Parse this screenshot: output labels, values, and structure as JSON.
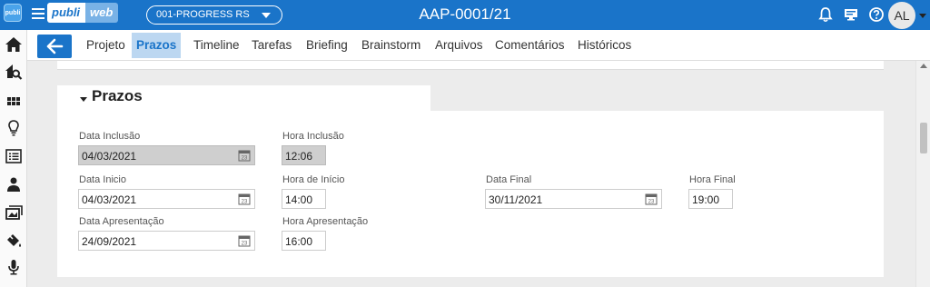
{
  "app": {
    "logo_text": "publi",
    "brand_left": "publi",
    "brand_right": "web",
    "company": "001-PROGRESS RS",
    "record_id": "AAP-0001/21",
    "user_initials": "AL"
  },
  "tabs": [
    {
      "label": "Projeto",
      "active": false
    },
    {
      "label": "Prazos",
      "active": true
    },
    {
      "label": "Timeline",
      "active": false
    },
    {
      "label": "Tarefas",
      "active": false
    },
    {
      "label": "Briefing",
      "active": false
    },
    {
      "label": "Brainstorm",
      "active": false
    },
    {
      "label": "Arquivos",
      "active": false
    },
    {
      "label": "Comentários",
      "active": false
    },
    {
      "label": "Históricos",
      "active": false
    }
  ],
  "section": {
    "title": "Prazos"
  },
  "form": {
    "data_inclusao": {
      "label": "Data Inclusão",
      "value": "04/03/2021"
    },
    "hora_inclusao": {
      "label": "Hora Inclusão",
      "value": "12:06"
    },
    "data_inicio": {
      "label": "Data Inicio",
      "value": "04/03/2021"
    },
    "hora_inicio": {
      "label": "Hora de Início",
      "value": "14:00"
    },
    "data_final": {
      "label": "Data Final",
      "value": "30/11/2021"
    },
    "hora_final": {
      "label": "Hora Final",
      "value": "19:00"
    },
    "data_apresentacao": {
      "label": "Data Apresentação",
      "value": "24/09/2021"
    },
    "hora_apresentacao": {
      "label": "Hora Apresentação",
      "value": "16:00"
    }
  },
  "icons": {
    "sidebar": [
      "home-icon",
      "search-home-icon",
      "dashboard-icon",
      "lightbulb-icon",
      "list-icon",
      "user-icon",
      "media-icon",
      "paint-bucket-icon",
      "microphone-icon"
    ],
    "topbar": [
      "bell-icon",
      "monitor-icon",
      "help-icon"
    ]
  },
  "colors": {
    "primary": "#1a74c9",
    "active_tab_bg": "#bcd7f1",
    "readonly_field": "#cfcfcf"
  }
}
